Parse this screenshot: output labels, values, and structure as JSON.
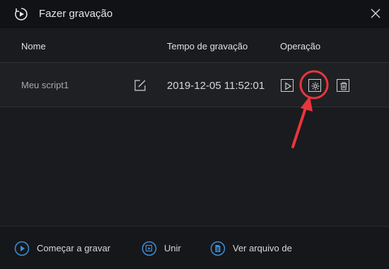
{
  "window": {
    "title": "Fazer gravação",
    "title_icon": "play-circle-icon",
    "close_icon": "close-icon"
  },
  "table": {
    "columns": [
      "Nome",
      "Tempo de gravação",
      "Operação"
    ],
    "rows": [
      {
        "name": "Meu script1",
        "edit_icon": "edit-icon",
        "time": "2019-12-05 11:52:01",
        "operations": [
          "play-icon",
          "gear-icon",
          "trash-icon"
        ]
      }
    ]
  },
  "footer": {
    "buttons": [
      {
        "label": "Começar a gravar",
        "icon": "record-play-icon"
      },
      {
        "label": "Unir",
        "icon": "merge-icon"
      },
      {
        "label": "Ver arquivo de",
        "icon": "file-icon"
      }
    ]
  },
  "colors": {
    "accent_blue": "#3d8fd6",
    "highlight_red": "#e8363c",
    "background": "#1a1b1f"
  }
}
